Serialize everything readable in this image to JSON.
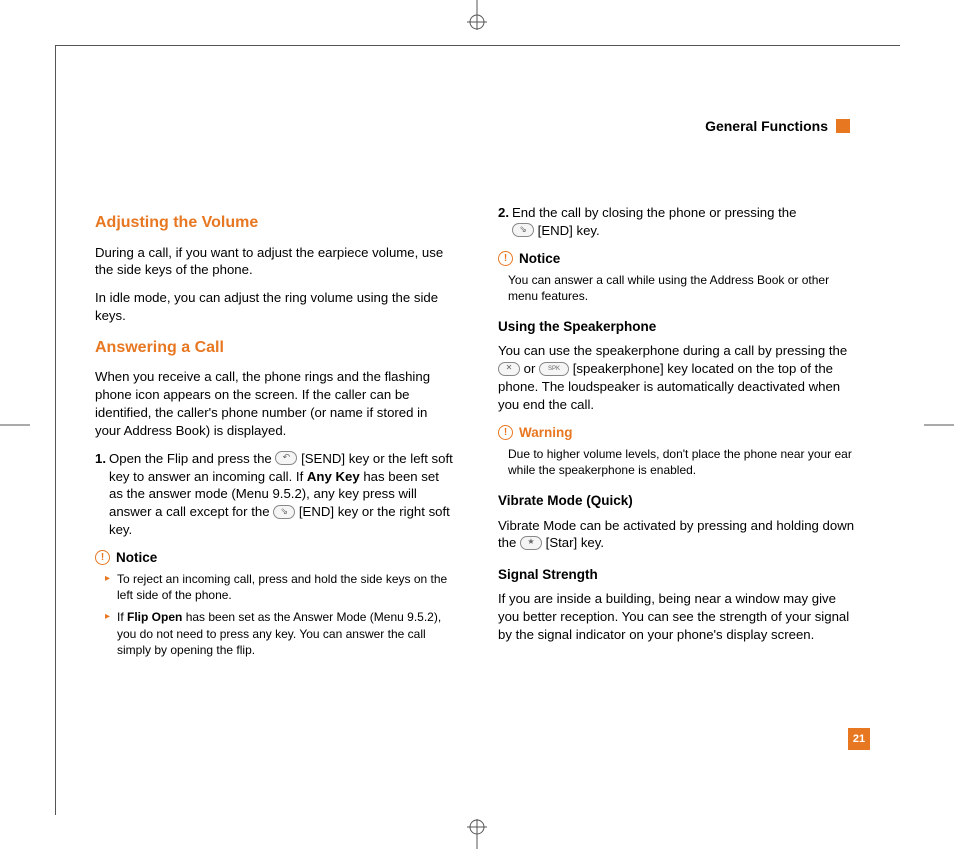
{
  "header": {
    "section": "General Functions"
  },
  "page_number": "21",
  "col1": {
    "h_volume": "Adjusting the Volume",
    "p_volume1": "During a call, if you want to adjust the earpiece volume, use the side keys of the phone.",
    "p_volume2": "In idle mode, you can adjust the ring volume using the side keys.",
    "h_answer": "Answering a Call",
    "p_answer1": "When you receive a call, the phone rings and the flashing phone icon appears on the screen. If the caller can be identified, the caller's phone number (or name if stored in your Address Book) is displayed.",
    "step1_num": "1.",
    "step1_a": "Open the Flip and press the ",
    "step1_b": " [SEND] key or the left soft key to answer an incoming call. If ",
    "step1_anykey": "Any Key",
    "step1_c": " has been set as the answer mode (Menu 9.5.2), any key press will answer a call except for the ",
    "step1_d": " [END] key or the right soft key.",
    "notice_label": "Notice",
    "notice_b1": "To reject an incoming call, press and hold the side keys on the left side of the phone.",
    "notice_b2a": "If ",
    "notice_b2_flip": "Flip Open",
    "notice_b2b": " has been set as the Answer Mode (Menu 9.5.2), you do not need to press any key. You can answer the call simply by opening the flip."
  },
  "col2": {
    "step2_num": "2.",
    "step2_a": "End the call by closing the phone or pressing the ",
    "step2_b": " [END] key.",
    "notice2_label": "Notice",
    "notice2_body": "You can answer a call while using the Address Book or other menu features.",
    "h_speaker": "Using the Speakerphone",
    "p_speaker1a": "You can use the speakerphone during a call by pressing the ",
    "p_speaker1b": " or ",
    "p_speaker1c": " [speakerphone] key located on the top of the phone. The loudspeaker is automatically deactivated when you end the call.",
    "warn_label": "Warning",
    "warn_body": "Due to higher volume levels, don't place the phone near your ear while the speakerphone is enabled.",
    "h_vibrate": "Vibrate Mode (Quick)",
    "p_vibrate_a": "Vibrate Mode can be activated by pressing and holding down the ",
    "p_vibrate_b": " [Star] key.",
    "h_signal": "Signal Strength",
    "p_signal": "If you are inside a building, being near a window may give you better reception. You can see the strength of your signal by the signal indicator on your phone's display screen."
  }
}
